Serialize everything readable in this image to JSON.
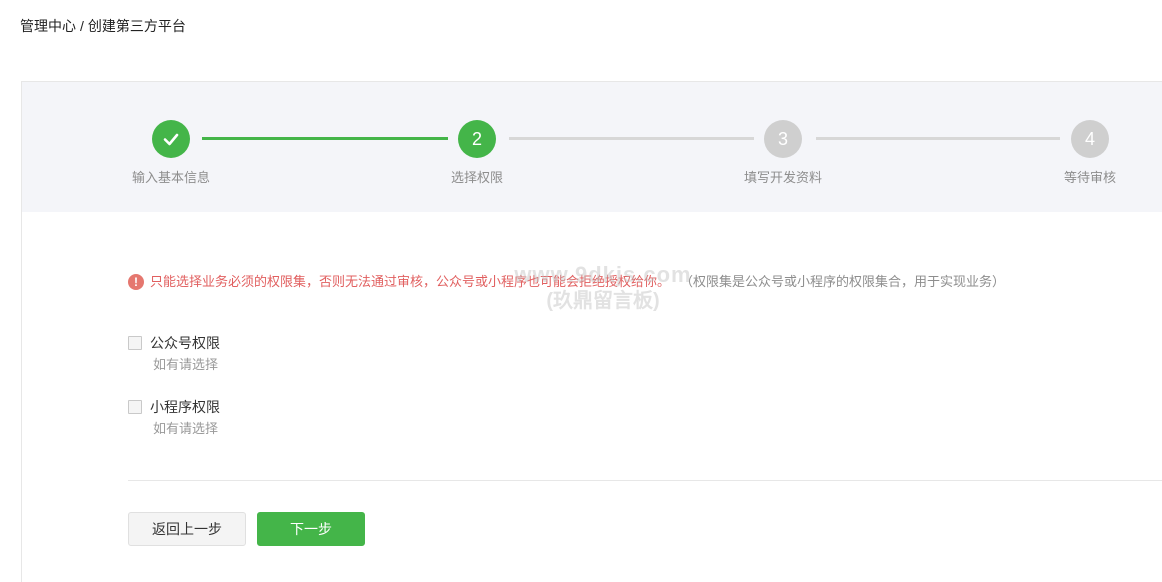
{
  "breadcrumb": {
    "root": "管理中心",
    "separator": "/",
    "current": "创建第三方平台"
  },
  "steps": [
    {
      "number": "1",
      "label": "输入基本信息",
      "status": "done",
      "icon": "check-icon"
    },
    {
      "number": "2",
      "label": "选择权限",
      "status": "active"
    },
    {
      "number": "3",
      "label": "填写开发资料",
      "status": "pending"
    },
    {
      "number": "4",
      "label": "等待审核",
      "status": "pending"
    }
  ],
  "notice": {
    "icon": "exclamation-icon",
    "icon_glyph": "!",
    "warning": "只能选择业务必须的权限集，否则无法通过审核，公众号或小程序也可能会拒绝授权给你。",
    "hint": "（权限集是公众号或小程序的权限集合，用于实现业务）"
  },
  "watermark": {
    "line1": "www.9dkjs.com",
    "line2": "(玖鼎留言板)"
  },
  "permissions": [
    {
      "title": "公众号权限",
      "description": "如有请选择",
      "checked": false
    },
    {
      "title": "小程序权限",
      "description": "如有请选择",
      "checked": false
    }
  ],
  "buttons": {
    "back": "返回上一步",
    "next": "下一步"
  },
  "colors": {
    "accent": "#44b549",
    "pending": "#cfcfcf",
    "warning": "#e15f5f",
    "steps_background": "#f4f5f9"
  }
}
